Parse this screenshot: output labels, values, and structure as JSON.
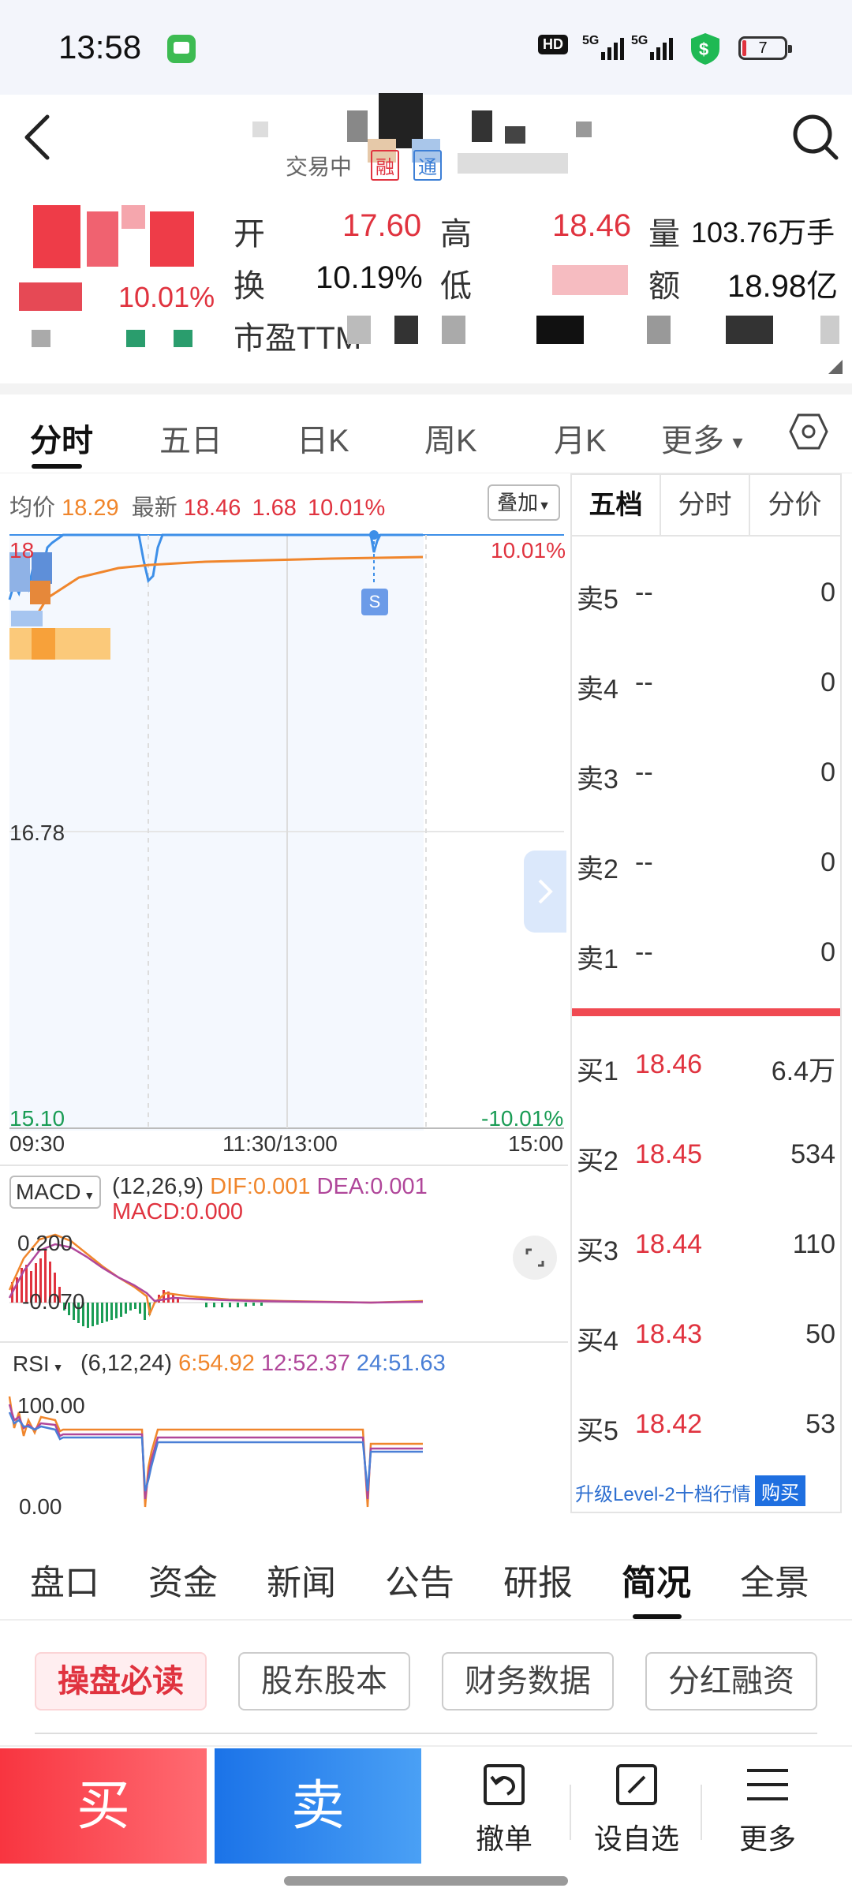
{
  "status_bar": {
    "time": "13:58",
    "network": "HD 5G 5G",
    "battery": "7"
  },
  "header": {
    "status_text": "交易中",
    "badge1": "融",
    "badge2": "通"
  },
  "quote": {
    "change_pct": "10.01%",
    "open_label": "开",
    "open_value": "17.60",
    "high_label": "高",
    "high_value": "18.46",
    "volume_label": "量",
    "volume_value": "103.76万手",
    "turnover_label": "换",
    "turnover_value": "10.19%",
    "low_label": "低",
    "amount_label": "额",
    "amount_value": "18.98亿",
    "pe_label": "市盈TTM"
  },
  "chart_tabs": [
    "分时",
    "五日",
    "日K",
    "周K",
    "月K",
    "更多"
  ],
  "chart_info": {
    "avg_label": "均价",
    "avg_value": "18.29",
    "latest_label": "最新",
    "latest_value": "18.46",
    "change_value": "1.68",
    "change_pct": "10.01%",
    "overlay_button": "叠加",
    "y_top_pct": "10.01%",
    "y_mid": "16.78",
    "y_bottom": "15.10",
    "y_bottom_pct": "-10.01%",
    "t_start": "09:30",
    "t_mid": "11:30/13:00",
    "t_end": "15:00",
    "marker": "S"
  },
  "macd": {
    "selector": "MACD",
    "params": "(12,26,9)",
    "dif": "DIF:0.001",
    "dea": "DEA:0.001",
    "macd": "MACD:0.000",
    "y_top": "0.200",
    "y_bottom": "-0.070"
  },
  "rsi": {
    "selector": "RSI",
    "params": "(6,12,24)",
    "rsi6": "6:54.92",
    "rsi12": "12:52.37",
    "rsi24": "24:51.63",
    "y_top": "100.00",
    "y_bottom": "0.00"
  },
  "order_book": {
    "tabs": [
      "五档",
      "分时",
      "分价"
    ],
    "asks": [
      {
        "label": "卖5",
        "price": "--",
        "volume": "0"
      },
      {
        "label": "卖4",
        "price": "--",
        "volume": "0"
      },
      {
        "label": "卖3",
        "price": "--",
        "volume": "0"
      },
      {
        "label": "卖2",
        "price": "--",
        "volume": "0"
      },
      {
        "label": "卖1",
        "price": "--",
        "volume": "0"
      }
    ],
    "bids": [
      {
        "label": "买1",
        "price": "18.46",
        "volume": "6.4万"
      },
      {
        "label": "买2",
        "price": "18.45",
        "volume": "534"
      },
      {
        "label": "买3",
        "price": "18.44",
        "volume": "110"
      },
      {
        "label": "买4",
        "price": "18.43",
        "volume": "50"
      },
      {
        "label": "买5",
        "price": "18.42",
        "volume": "53"
      }
    ],
    "upgrade_text": "升级Level-2十档行情",
    "buy_badge": "购买"
  },
  "info_tabs": [
    "盘口",
    "资金",
    "新闻",
    "公告",
    "研报",
    "简况",
    "全景"
  ],
  "info_pills": [
    "操盘必读",
    "股东股本",
    "财务数据",
    "分红融资"
  ],
  "bottom_bar": {
    "buy": "买",
    "sell": "卖",
    "cancel": "撤单",
    "watch": "设自选",
    "more": "更多"
  },
  "colors": {
    "up": "#e0333f",
    "down": "#1a9c55",
    "price_line": "#3d8fe8",
    "avg_line": "#f0862c",
    "buy_button": "#f83540",
    "sell_button": "#1b73e8"
  }
}
